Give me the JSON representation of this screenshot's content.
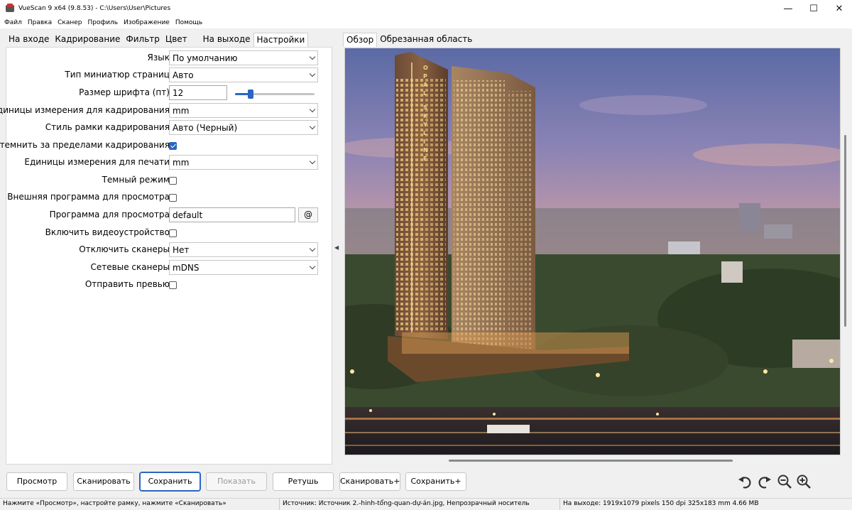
{
  "window": {
    "title": "VueScan 9 x64 (9.8.53) - C:\\Users\\User\\Pictures",
    "minimize": "—",
    "maximize": "☐",
    "close": "✕"
  },
  "menu": [
    "Файл",
    "Правка",
    "Сканер",
    "Профиль",
    "Изображение",
    "Помощь"
  ],
  "left_tabs": [
    {
      "label": "На входе",
      "active": false
    },
    {
      "label": "Кадрирование",
      "active": false
    },
    {
      "label": "Фильтр",
      "active": false
    },
    {
      "label": "Цвет",
      "active": false
    },
    {
      "label": "На выходе",
      "active": false
    },
    {
      "label": "Настройки",
      "active": true
    }
  ],
  "right_tabs": [
    {
      "label": "Обзор",
      "active": true
    },
    {
      "label": "Обрезанная область",
      "active": false
    }
  ],
  "settings": {
    "language": {
      "label": "Язык:",
      "value": "По умолчанию"
    },
    "thumb_type": {
      "label": "Тип миниатюр страниц:",
      "value": "Авто"
    },
    "font_size": {
      "label": "Размер шрифта (пт):",
      "value": "12",
      "slider_fraction": 0.2
    },
    "crop_units": {
      "label": "Единицы измерения для кадрирования:",
      "value": "mm"
    },
    "crop_frame": {
      "label": "Стиль рамки кадрирования:",
      "value": "Авто (Черный)"
    },
    "darken_outside": {
      "label": "Затемнить за пределами кадрирования:",
      "checked": true
    },
    "print_units": {
      "label": "Единицы измерения для печати:",
      "value": "mm"
    },
    "dark_mode": {
      "label": "Темный режим:",
      "checked": false
    },
    "external_viewer": {
      "label": "Внешняя программа для просмотра:",
      "checked": false
    },
    "viewer_program": {
      "label": "Программа для просмотра:",
      "value": "default",
      "button": "@"
    },
    "video_device": {
      "label": "Включить видеоустройство:",
      "checked": false
    },
    "disable_scanners": {
      "label": "Отключить сканеры:",
      "value": "Нет"
    },
    "network_scanners": {
      "label": "Сетевые сканеры:",
      "value": "mDNS"
    },
    "send_preview": {
      "label": "Отправить превью:",
      "checked": false
    }
  },
  "preview": {
    "sign_letters": "OPAL SKYLINE"
  },
  "buttons": {
    "preview": "Просмотр",
    "scan": "Сканировать",
    "save": "Сохранить",
    "show": "Показать",
    "retouch": "Ретушь",
    "scan_plus": "Сканировать+",
    "save_plus": "Сохранить+"
  },
  "status": {
    "left": "Нажмите «Просмотр», настройте рамку, нажмите «Сканировать»",
    "middle": "Источник: Источник 2.-hinh-tổng-quan-dự-án.jpg, Непрозрачный носитель",
    "right": "На выходе: 1919x1079 pixels 150 dpi 325x183 mm 4.66 MB"
  },
  "colors": {
    "accent": "#2b65c3"
  }
}
